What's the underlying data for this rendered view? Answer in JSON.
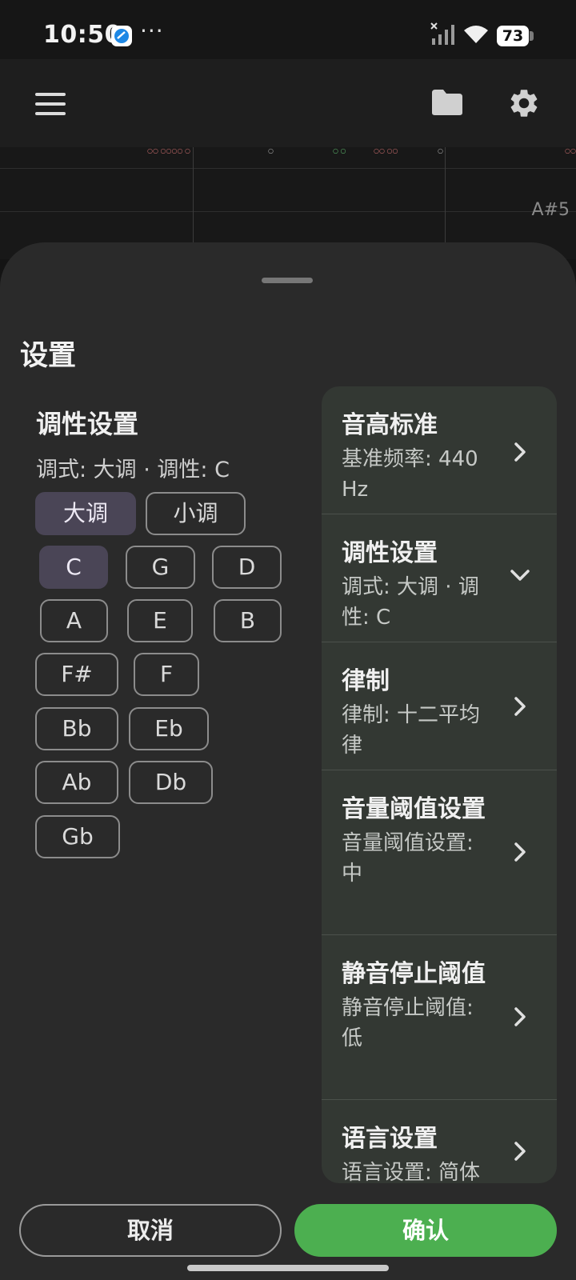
{
  "status_bar": {
    "time": "10:50",
    "dots": "···",
    "battery": "73"
  },
  "graph": {
    "note_label": "A#5"
  },
  "sheet": {
    "title": "设置"
  },
  "key_settings": {
    "title": "调性设置",
    "summary": "调式: 大调 · 调性: C",
    "modes": [
      "大调",
      "小调"
    ],
    "selected_mode": "大调",
    "keys": [
      "C",
      "G",
      "D",
      "A",
      "E",
      "B",
      "F#",
      "F",
      "Bb",
      "Eb",
      "Ab",
      "Db",
      "Gb"
    ],
    "selected_key": "C"
  },
  "menu": {
    "items": [
      {
        "title": "音高标准",
        "subtitle": "基准频率: 440 Hz",
        "icon": "chevron-right-icon"
      },
      {
        "title": "调性设置",
        "subtitle": "调式: 大调 · 调性: C",
        "icon": "chevron-down-icon"
      },
      {
        "title": "律制",
        "subtitle": "律制: 十二平均律",
        "icon": "chevron-right-icon"
      },
      {
        "title": "音量阈值设置",
        "subtitle": "音量阈值设置: 中",
        "icon": "chevron-right-icon"
      },
      {
        "title": "静音停止阈值",
        "subtitle": "静音停止阈值: 低",
        "icon": "chevron-right-icon"
      },
      {
        "title": "语言设置",
        "subtitle": "语言设置: 简体",
        "icon": "chevron-right-icon"
      }
    ]
  },
  "buttons": {
    "cancel": "取消",
    "confirm": "确认"
  },
  "colors": {
    "confirm": "#4caf50",
    "selected_chip": "#4a4556",
    "panel": "#333833"
  }
}
